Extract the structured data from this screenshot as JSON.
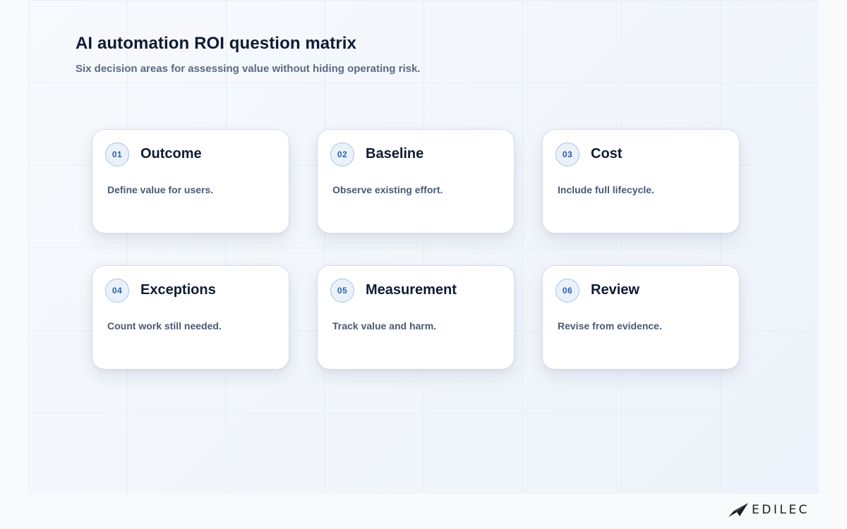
{
  "header": {
    "title": "AI automation ROI question matrix",
    "subtitle": "Six decision areas for assessing value without hiding operating risk."
  },
  "cards": [
    {
      "number": "01",
      "title": "Outcome",
      "description": "Define value for users."
    },
    {
      "number": "02",
      "title": "Baseline",
      "description": "Observe existing effort."
    },
    {
      "number": "03",
      "title": "Cost",
      "description": "Include full lifecycle."
    },
    {
      "number": "04",
      "title": "Exceptions",
      "description": "Count work still needed."
    },
    {
      "number": "05",
      "title": "Measurement",
      "description": "Track value and harm."
    },
    {
      "number": "06",
      "title": "Review",
      "description": "Revise from evidence."
    }
  ],
  "brand": {
    "name": "EDILEC",
    "logo_icon": "paper-plane-icon"
  },
  "colors": {
    "accent": "#2e5ea8",
    "title": "#0f1b33",
    "muted": "#5b6b82"
  }
}
